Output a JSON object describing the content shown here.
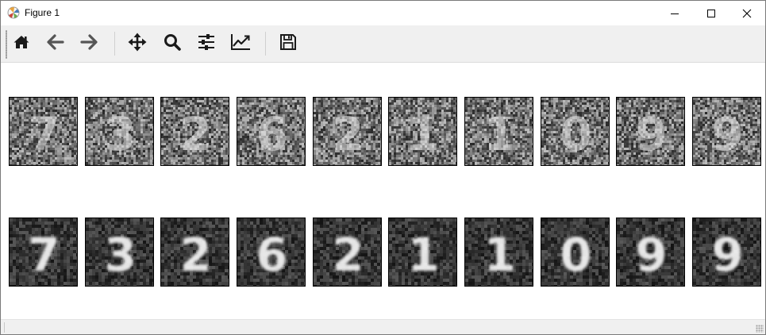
{
  "window": {
    "title": "Figure 1",
    "app_icon": "matplotlib-icon",
    "controls": [
      "minimize-icon",
      "maximize-icon",
      "close-icon"
    ]
  },
  "toolbar": {
    "buttons": [
      {
        "name": "home-button",
        "icon": "home-icon"
      },
      {
        "name": "back-button",
        "icon": "back-arrow-icon"
      },
      {
        "name": "forward-button",
        "icon": "forward-arrow-icon"
      },
      {
        "name": "pan-button",
        "icon": "move-icon"
      },
      {
        "name": "zoom-button",
        "icon": "zoom-icon"
      },
      {
        "name": "subplots-button",
        "icon": "sliders-icon"
      },
      {
        "name": "customize-button",
        "icon": "line-chart-icon"
      },
      {
        "name": "save-button",
        "icon": "save-icon"
      }
    ]
  },
  "figure": {
    "rows": [
      {
        "kind": "noisy",
        "digits": [
          "7",
          "3",
          "2",
          "6",
          "2",
          "1",
          "1",
          "0",
          "9",
          "9"
        ]
      },
      {
        "kind": "reconstructed",
        "digits": [
          "7",
          "3",
          "2",
          "6",
          "2",
          "1",
          "1",
          "0",
          "9",
          "9"
        ]
      }
    ]
  },
  "colors": {
    "titlebar_bg": "#ffffff",
    "toolbar_bg": "#f0f0f0",
    "statusbar_bg": "#f0f0f0",
    "icon_color": "#1a1a1a"
  }
}
